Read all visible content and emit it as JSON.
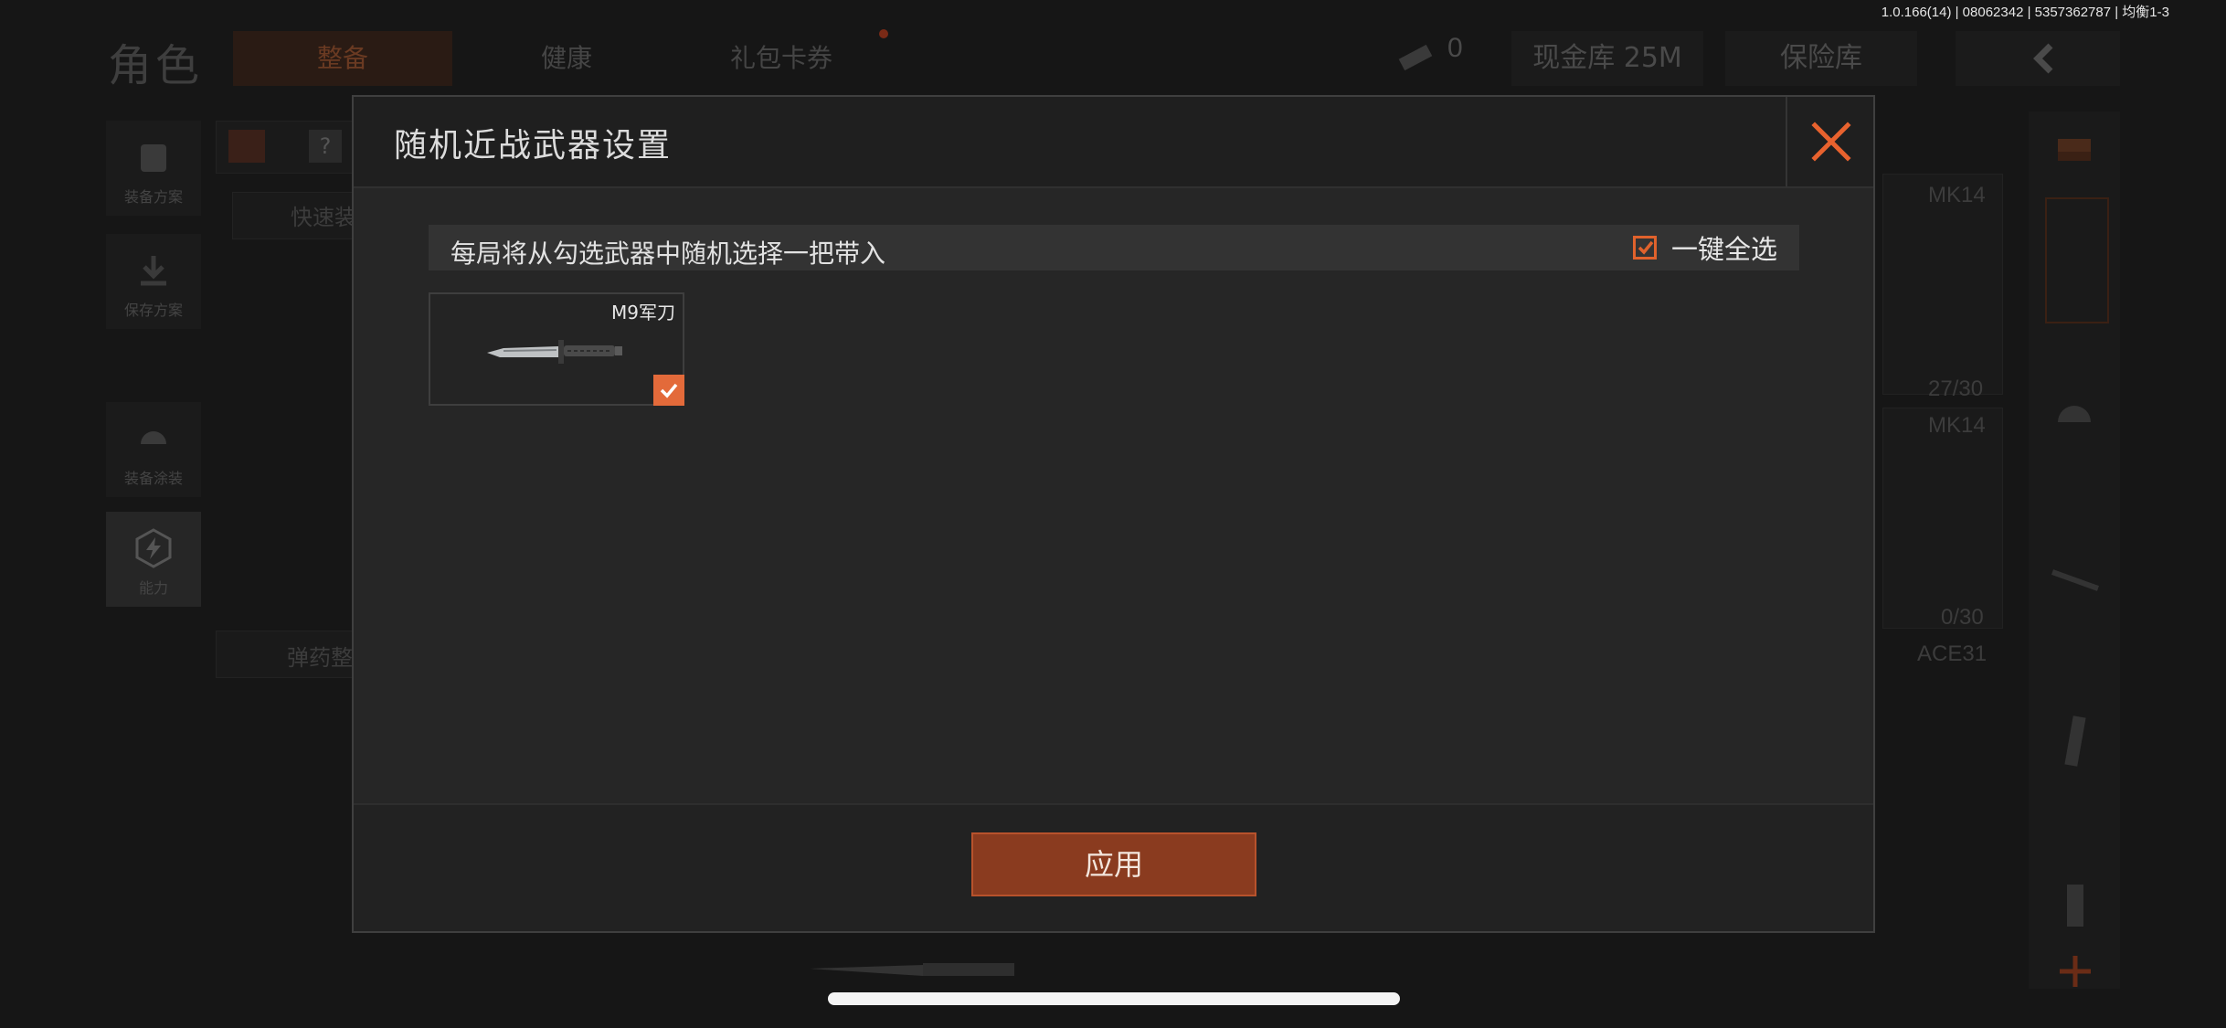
{
  "app": {
    "version_info": "1.0.166(14) | 08062342 | 5357362787 | 均衡1-3"
  },
  "background": {
    "page_title": "角色",
    "tabs": [
      "整备",
      "健康",
      "礼包卡券"
    ],
    "currency_count": "0",
    "cash_vault": "现金库 25M",
    "safe_box": "保险库",
    "side_menu": [
      "装备方案",
      "保存方案",
      "装备涂装",
      "能力"
    ],
    "quick_label": "快速装",
    "ammo_label": "弹药整",
    "slot_labels": [
      "MK14",
      "27/30",
      "MK14",
      "0/30",
      "ACE31"
    ],
    "hint_icon": "?"
  },
  "modal": {
    "title": "随机近战武器设置",
    "hint": "每局将从勾选武器中随机选择一把带入",
    "select_all_label": "一键全选",
    "select_all_checked": true,
    "weapons": [
      {
        "name": "M9军刀",
        "checked": true,
        "icon": "combat-knife-icon"
      }
    ],
    "apply_label": "应用"
  },
  "colors": {
    "accent": "#e36a3a",
    "apply_bg": "#8a3b1f",
    "close_icon": "#e8622e"
  }
}
